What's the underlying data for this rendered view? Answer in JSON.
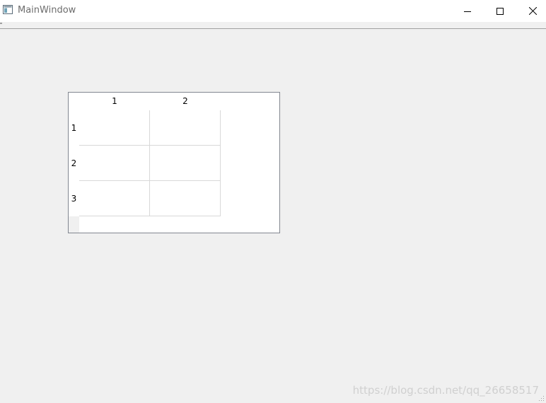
{
  "window": {
    "title": "MainWindow",
    "icon": "app-window-icon",
    "controls": {
      "minimize_icon": "minimize-icon",
      "maximize_icon": "maximize-icon",
      "close_icon": "close-icon"
    }
  },
  "table": {
    "column_headers": [
      "1",
      "2"
    ],
    "row_headers": [
      "1",
      "2",
      "3"
    ],
    "cells": [
      [
        "",
        ""
      ],
      [
        "",
        ""
      ],
      [
        "",
        ""
      ]
    ]
  },
  "watermark": "https://blog.csdn.net/qq_26658517",
  "colors": {
    "window_bg": "#f0f0f0",
    "titlebar_bg": "#ffffff",
    "table_border": "#828790",
    "grid_line": "#d8d8d8"
  }
}
